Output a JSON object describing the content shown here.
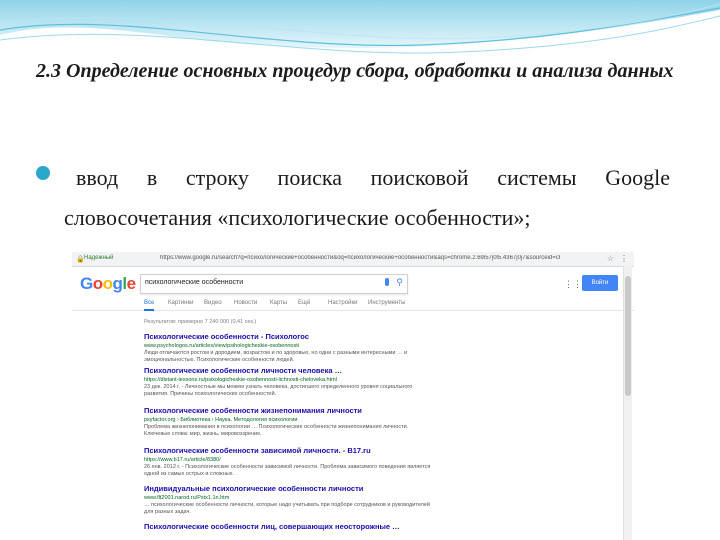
{
  "slide": {
    "title": "2.3 Определение основных процедур сбора, обработки и анализа данных",
    "bullet_line1": "ввод в строку поиска поисковой системы Google",
    "bullet_line2": "словосочетания «психологические особенности»;",
    "accent_color": "#2aa7c9"
  },
  "browser": {
    "secure_label": "Надежный",
    "url": "https://www.google.ru/search?q=психологические+особенности&oq=психологические+особенности&aqs=chrome.2.69i57j0l5.4367j0j7&sourceid=chrome&ie=UTF-8",
    "logo_letters": [
      "G",
      "o",
      "o",
      "g",
      "l",
      "e"
    ],
    "query": "психологические особенности",
    "signin_label": "Войти",
    "tabs": [
      "Все",
      "Картинки",
      "Видео",
      "Новости",
      "Карты",
      "Ещё",
      "Настройки",
      "Инструменты"
    ],
    "stats": "Результатов: примерно 7 240 000 (0,41 сек.)",
    "results": [
      {
        "title": "Психологические особенности - Психологос",
        "url": "www.psychologos.ru/articles/view/psihologicheskie-osobennosti",
        "snippet": "Люди отличаются ростом и дородием, возрастом и по здоровью, но одни с разными интересными … и эмоциональностью. Психологические особенности людей."
      },
      {
        "title": "Психологические особенности личности человека …",
        "url": "https://distant-lessons.ru/psixologicheskie-osobennosti-lichnosti-cheloveka.html",
        "snippet": "23 дек. 2014 г. - Личностные мы можем узнать человека, достигшего определенного уровня социального развития. Причины психологических особенностей."
      },
      {
        "title": "Психологические особенности жизнепонимания личности",
        "url": "psyfactor.org › Библиотека › Наука. Методология психологии",
        "snippet": "Проблема жизнепонимания в психологии … Психологические особенности жизнепонимания личности. Ключевые слова: мир, жизнь, мировоззрение."
      },
      {
        "title": "Психологические особенности зависимой личности. - В17.ru",
        "url": "https://www.b17.ru/article/8380/",
        "snippet": "26 янв. 2012 г. - Психологические особенности зависимой личности. Проблема зависимого поведения является одной из самых острых и сложных."
      },
      {
        "title": "Индивидуальные психологические особенности личности",
        "url": "www.flt2001.narod.ru/Pstx1.1n.htm",
        "snippet": "… психологические особенности личности, которые надо учитывать при подборе сотрудников и руководителей для разных задач."
      },
      {
        "title": "Психологические особенности лиц, совершающих неосторожные …",
        "url": "",
        "snippet": ""
      }
    ]
  }
}
